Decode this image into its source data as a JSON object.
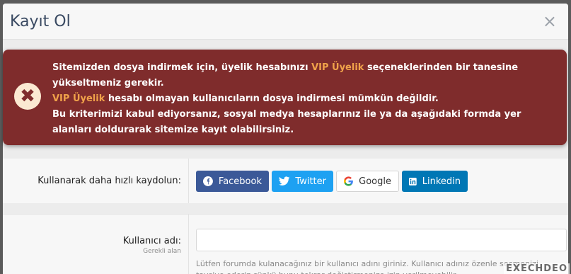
{
  "modal": {
    "title": "Kayıt Ol",
    "close_glyph": "×"
  },
  "alert": {
    "line1_pre": "Sitemizden dosya indirmek için, üyelik hesabınızı ",
    "line1_hl": "VIP Üyelik",
    "line1_post": " seçeneklerinden bir tanesine yükseltmeniz gerekir.",
    "line2_hl": "VIP Üyelik",
    "line2_post": " hesabı olmayan kullanıcıların dosya indirmesi mümkün değildir.",
    "line3": "Bu kriterimizi kabul ediyorsanız, sosyal medya hesaplarınız ile ya da aşağıdaki formda yer alanları doldurarak sitemize kayıt olabilirsiniz.",
    "icon": "times-circle-icon",
    "highlight_color": "#f0a24a"
  },
  "social": {
    "label": "Kullanarak daha hızlı kaydolun:",
    "buttons": [
      {
        "label": "Facebook",
        "icon": "facebook-icon",
        "color": "#3b5998"
      },
      {
        "label": "Twitter",
        "icon": "twitter-icon",
        "color": "#1da1f2"
      },
      {
        "label": "Google",
        "icon": "google-icon",
        "color": "#ffffff"
      },
      {
        "label": "Linkedin",
        "icon": "linkedin-icon",
        "color": "#0077b5"
      }
    ]
  },
  "username": {
    "label": "Kullanıcı adı:",
    "required": "Gerekli alan",
    "value": "",
    "hint": "Lütfen forumda kulanacağınız bir kullanıcı adını giriniz. Kullanıcı adınız özenle seçmenizi tavsiye ederiz çünkü bunu tekrar değiştirmenize izin verilmeyebilir."
  },
  "watermark": "EXECHDEO"
}
